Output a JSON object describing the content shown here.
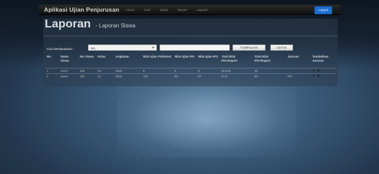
{
  "navbar": {
    "brand": "Aplikasi Ujian Penjurusan",
    "items": [
      "Home",
      "Soal",
      "Siswa",
      "Report",
      "Laporan"
    ],
    "logout_label": "Logout",
    "logout_color": "#1e6fd0"
  },
  "page": {
    "title": "Laporan",
    "subtitle": "- Laporan Siswa"
  },
  "search": {
    "label": "Cari berdasarkan :",
    "select_value": "Nis",
    "input_value": "",
    "submit_label": "TAMPILKAN",
    "print_label": "CETAK"
  },
  "table": {
    "headers": [
      "No.",
      "Nama Siswa",
      "Nis Siswa",
      "Kelas",
      "Angkatan",
      "Nilai Ujian Psikotest",
      "Nilai Ujian IPA",
      "Nilai Ujian IPS",
      "Total Nilai IPA+Raport",
      "Total Nilai IPS+Raport",
      "Jurusan",
      "Tambahkan Jurusan"
    ],
    "rows": [
      [
        "1",
        "ALDY",
        "102",
        "X1",
        "2015",
        "0",
        "0",
        "0",
        "36.375",
        "42",
        "",
        ""
      ],
      [
        "2",
        "nama",
        "101",
        "x1",
        "2015",
        "720",
        "65",
        "57",
        "67.5",
        "60",
        "IPS",
        ""
      ]
    ],
    "row_action_icons": [
      "pencil-icon",
      "trash-icon"
    ]
  }
}
